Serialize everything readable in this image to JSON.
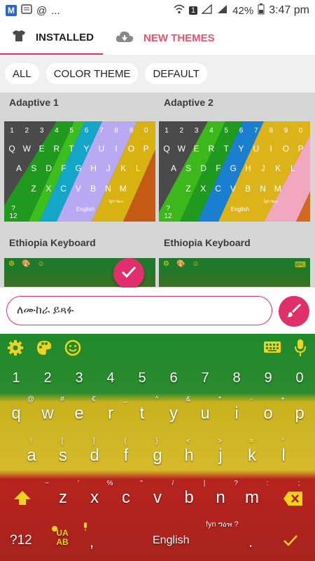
{
  "status_bar": {
    "time": "3:47 pm",
    "battery": "42%",
    "sim": "1",
    "dots": "...",
    "m_badge": "M"
  },
  "tabs": {
    "installed": "INSTALLED",
    "new_themes": "NEW THEMES"
  },
  "filters": [
    "ALL",
    "COLOR THEME",
    "DEFAULT"
  ],
  "themes": [
    {
      "name": "Adaptive 1"
    },
    {
      "name": "Adaptive 2"
    },
    {
      "name": "Ethiopia Keyboard"
    },
    {
      "name": "Ethiopia Keyboard"
    }
  ],
  "thumb": {
    "numbers": [
      "1",
      "2",
      "3",
      "4",
      "5",
      "6",
      "7",
      "8",
      "9",
      "0"
    ],
    "row1": [
      "Q",
      "W",
      "E",
      "R",
      "T",
      "Y",
      "U",
      "I",
      "O",
      "P"
    ],
    "row2": [
      "A",
      "S",
      "D",
      "F",
      "G",
      "H",
      "J",
      "K",
      "L"
    ],
    "row3": [
      "Z",
      "X",
      "C",
      "V",
      "B",
      "N",
      "M"
    ],
    "sym": "?12",
    "space": "English",
    "fyn": "fyn ግዕዝ"
  },
  "input": {
    "value": "ለሙከራ ይጻፉ"
  },
  "keyboard": {
    "numbers": [
      "1",
      "2",
      "3",
      "4",
      "5",
      "6",
      "7",
      "8",
      "9",
      "0"
    ],
    "num_hints": [
      "@",
      "#",
      "€",
      "_",
      "^",
      "&",
      "*",
      "-",
      "+"
    ],
    "row1": [
      "q",
      "w",
      "e",
      "r",
      "t",
      "y",
      "u",
      "i",
      "o",
      "p"
    ],
    "row1_hints": [
      "!",
      "[",
      "]",
      "{",
      "}",
      "<",
      ">",
      "=",
      "°"
    ],
    "row2": [
      "a",
      "s",
      "d",
      "f",
      "g",
      "h",
      "j",
      "k",
      "l"
    ],
    "row2_hints": [
      "~",
      "'",
      "%",
      "\"",
      "/",
      "|",
      "?",
      ":",
      ";"
    ],
    "row3": [
      "z",
      "x",
      "c",
      "v",
      "b",
      "n",
      "m"
    ],
    "sym": "?12",
    "lang_switch": "UA AB",
    "comma": ",",
    "space": "English",
    "period": ".",
    "fyn": "fyn ግዕዝ ?"
  },
  "colors": {
    "accent": "#e12f6d",
    "new_themes": "#e8546f",
    "icon_yellow": "#f2d31b"
  }
}
